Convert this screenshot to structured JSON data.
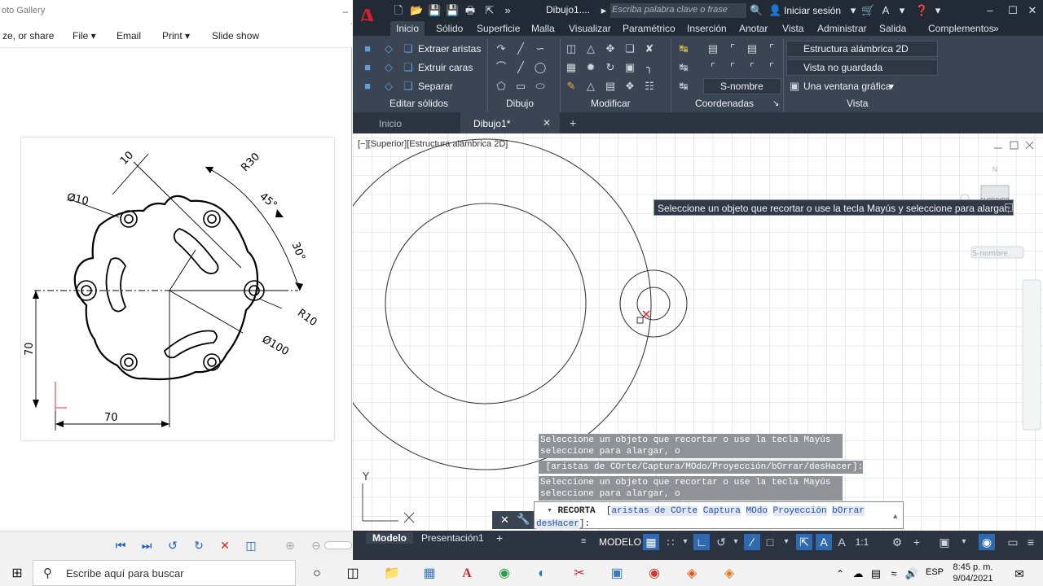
{
  "photo_gallery": {
    "title": "oto Gallery",
    "menu": [
      "ze, or share",
      "File ▾",
      "Email",
      "Print ▾",
      "Slide show"
    ],
    "drawing_labels": {
      "dim_10": "10",
      "dia_10": "Ø10",
      "r30": "R30",
      "ang45": "45°",
      "ang30": "30°",
      "r10": "R10",
      "dia_100": "Ø100",
      "v70": "70",
      "h70": "70"
    }
  },
  "autocad": {
    "doc_title": "Dibujo1....",
    "search_placeholder": "Escriba palabra clave o frase",
    "login": "Iniciar sesión",
    "ribbon_tabs": [
      "Inicio",
      "Sólido",
      "Superficie",
      "Malla",
      "Visualizar",
      "Paramétrico",
      "Inserción",
      "Anotar",
      "Vista",
      "Administrar",
      "Salida",
      "Complementos"
    ],
    "solid_tools": [
      "Extraer aristas",
      "Extruir caras",
      "Separar"
    ],
    "panels": [
      "Editar sólidos",
      "Dibujo",
      "Modificar",
      "Coordenadas",
      "Vista"
    ],
    "coord_combo": "S-nombre",
    "view_combos": [
      "Estructura alámbrica 2D",
      "Vista no guardada",
      "Una ventana gráfica"
    ],
    "file_tabs": [
      "Inicio",
      "Dibujo1*"
    ],
    "viewport_label": "[−][Superior][Estructura alámbrica 2D]",
    "viewcube": {
      "face": "SUPERIOR",
      "north": "N",
      "wcs": "S-nombre"
    },
    "tooltip": "Seleccione un objeto que recortar o use la tecla Mayús y seleccione para alargar, o",
    "history": [
      "Seleccione un objeto que recortar o use la tecla Mayús y",
      "seleccione para alargar, o",
      " [aristas de COrte/Captura/MOdo/Proyección/bOrrar/desHacer]:",
      "Seleccione un objeto que recortar o use la tecla Mayús y",
      "seleccione para alargar, o"
    ],
    "command": {
      "name": "RECORTA",
      "options": [
        "aristas de COrte",
        "Captura",
        "MOdo",
        "Proyección",
        "bOrrar",
        "desHacer"
      ],
      "suffix": "]:"
    },
    "layout_tabs": [
      "Modelo",
      "Presentación1"
    ],
    "status_model": "MODELO",
    "status_scale": "1:1"
  },
  "taskbar": {
    "search": "Escribe aquí para buscar",
    "lang": "ESP",
    "time": "8:45 p. m.",
    "date": "9/04/2021"
  }
}
